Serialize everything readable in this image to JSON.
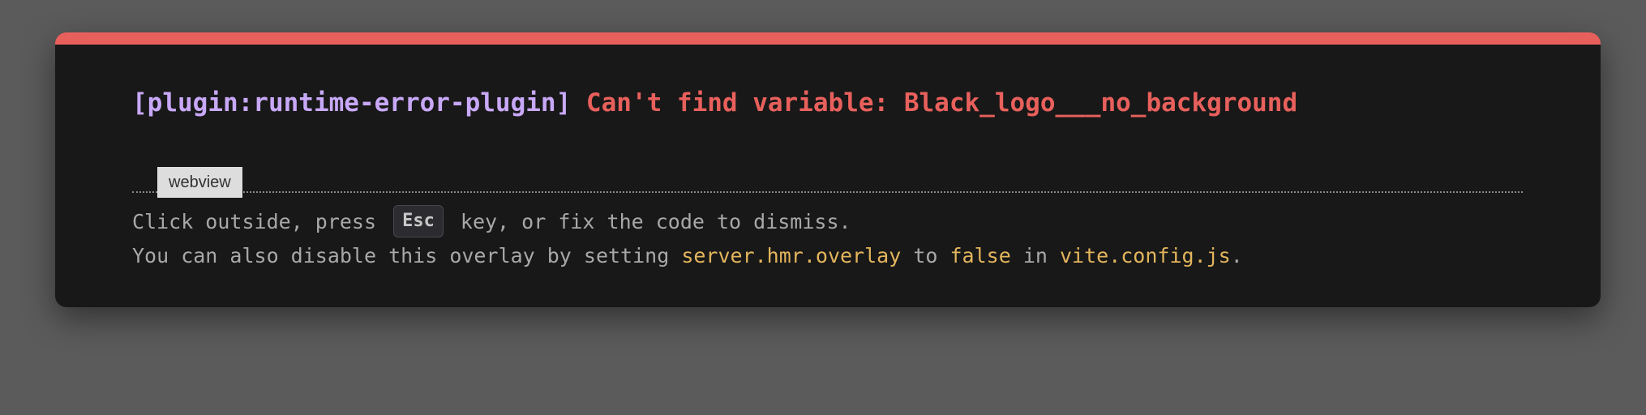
{
  "overlay": {
    "plugin_tag": "[plugin:runtime-error-plugin]",
    "error_message": "Can't find variable: Black_logo___no_background",
    "frame_tab_label": "webview",
    "tip_line1": {
      "before": "Click outside, press",
      "key": "Esc",
      "after": "key, or fix the code to dismiss."
    },
    "tip_line2": {
      "t1": "You can also disable this overlay by setting",
      "c1": "server.hmr.overlay",
      "t2": "to",
      "c2": "false",
      "t3": "in",
      "c3": "vite.config.js",
      "t4": "."
    }
  },
  "colors": {
    "backdrop": "#5b5b5b",
    "window_bg": "#181818",
    "accent_red": "#e8605c",
    "plugin_purple": "#c8a8f8",
    "code_yellow": "#e3b55c",
    "tip_gray": "#a8a8a8"
  }
}
